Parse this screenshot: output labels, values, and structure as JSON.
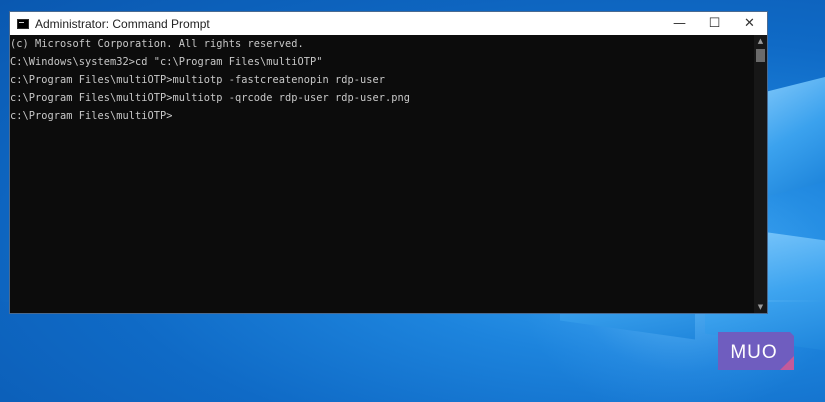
{
  "window": {
    "title": "Administrator: Command Prompt",
    "controls": {
      "minimize": "—",
      "maximize": "☐",
      "close": "✕"
    }
  },
  "console": {
    "lines": [
      "(c) Microsoft Corporation. All rights reserved.",
      "",
      "C:\\Windows\\system32>cd \"c:\\Program Files\\multiOTP\"",
      "",
      "c:\\Program Files\\multiOTP>multiotp -fastcreatenopin rdp-user",
      "",
      "c:\\Program Files\\multiOTP>multiotp -qrcode rdp-user rdp-user.png",
      "",
      "c:\\Program Files\\multiOTP>"
    ]
  },
  "scrollbar": {
    "up_arrow": "▲",
    "down_arrow": "▼"
  },
  "watermark": {
    "text": "MUO"
  },
  "colors": {
    "console_bg": "#0c0c0c",
    "console_text": "#c8c8c8",
    "desktop_blue": "#0f6ac6",
    "logo_bg": "#6f5dbf"
  },
  "icons": {
    "app": "cmd-console-icon",
    "minimize": "minimize-icon",
    "maximize": "maximize-icon",
    "close": "close-icon"
  }
}
